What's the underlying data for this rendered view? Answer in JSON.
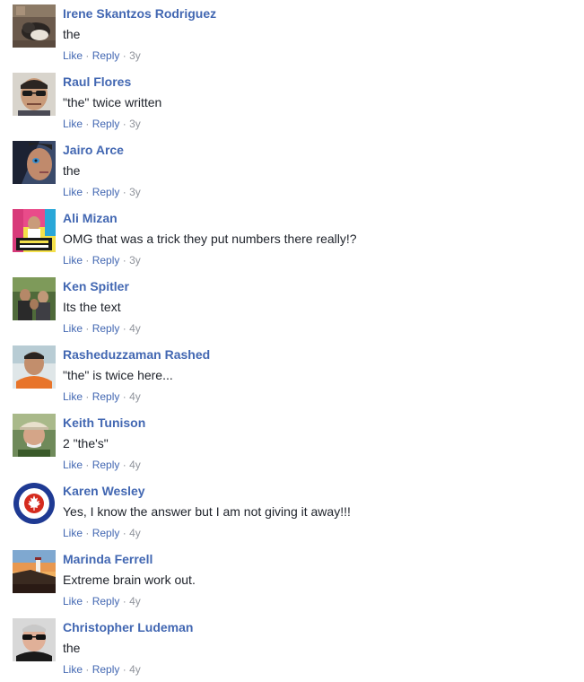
{
  "actions": {
    "like": "Like",
    "reply": "Reply",
    "separator": "·"
  },
  "comments": [
    {
      "name": "Irene Skantzos Rodriguez",
      "text": "the",
      "age": "3y",
      "avatar": "avatar-cat-photo"
    },
    {
      "name": "Raul Flores",
      "text": "\"the\" twice written",
      "age": "3y",
      "avatar": "avatar-man-sunglasses"
    },
    {
      "name": "Jairo Arce",
      "text": "the",
      "age": "3y",
      "avatar": "avatar-face-closeup"
    },
    {
      "name": "Ali Mizan",
      "text": "OMG that was a trick they put numbers there really!?",
      "age": "3y",
      "avatar": "avatar-colorful-poster"
    },
    {
      "name": "Ken Spitler",
      "text": "Its the text",
      "age": "4y",
      "avatar": "avatar-group-outdoors"
    },
    {
      "name": "Rasheduzzaman Rashed",
      "text": "\"the\" is twice here...",
      "age": "4y",
      "avatar": "avatar-man-orange-shirt"
    },
    {
      "name": "Keith Tunison",
      "text": "2 \"the's\"",
      "age": "4y",
      "avatar": "avatar-man-cap"
    },
    {
      "name": "Karen Wesley",
      "text": "Yes, I know the answer but I am not giving it away!!!",
      "age": "4y",
      "avatar": "avatar-roundel-maple-leaf"
    },
    {
      "name": "Marinda Ferrell",
      "text": "Extreme brain work out.",
      "age": "4y",
      "avatar": "avatar-lighthouse-sunset"
    },
    {
      "name": "Christopher Ludeman",
      "text": "the",
      "age": "4y",
      "avatar": "avatar-man-glasses"
    }
  ],
  "colors": {
    "name": "#4267b2",
    "text": "#1d2129",
    "meta_link": "#4267b2",
    "meta_muted": "#90949c",
    "roundel_red": "#d52b1e",
    "roundel_blue": "#1f3a93"
  }
}
